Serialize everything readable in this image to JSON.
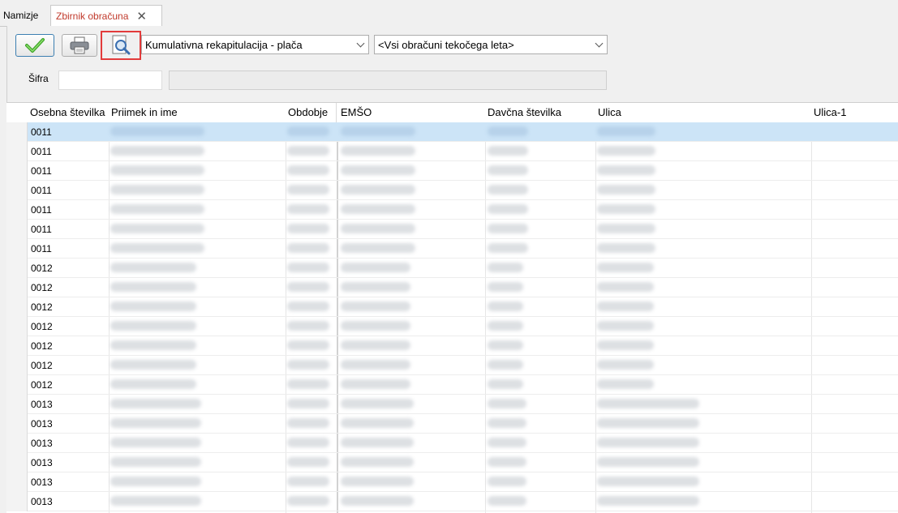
{
  "tabs": [
    {
      "label": "Namizje"
    },
    {
      "label": "Zbirnik obračuna"
    }
  ],
  "toolbar": {
    "ok_icon": "checkmark-icon",
    "print_icon": "printer-icon",
    "preview_icon": "print-preview-icon",
    "report_select": "Kumulativna rekapitulacija - plača",
    "period_select": "<Vsi obračuni tekočega leta>"
  },
  "filter": {
    "sifra_label": "Šifra",
    "sifra_value": "",
    "sifra_description": ""
  },
  "grid": {
    "columns": [
      "Osebna številka",
      "Priimek in ime",
      "Obdobje",
      "EMŠO",
      "Davčna številka",
      "Ulica",
      "Ulica-1"
    ],
    "rows": [
      {
        "id": "0011",
        "selected": true
      },
      {
        "id": "0011"
      },
      {
        "id": "0011"
      },
      {
        "id": "0011"
      },
      {
        "id": "0011"
      },
      {
        "id": "0011"
      },
      {
        "id": "0011"
      },
      {
        "id": "0012"
      },
      {
        "id": "0012"
      },
      {
        "id": "0012"
      },
      {
        "id": "0012"
      },
      {
        "id": "0012"
      },
      {
        "id": "0012"
      },
      {
        "id": "0012"
      },
      {
        "id": "0013"
      },
      {
        "id": "0013"
      },
      {
        "id": "0013"
      },
      {
        "id": "0013"
      },
      {
        "id": "0013"
      },
      {
        "id": "0013"
      }
    ]
  },
  "colors": {
    "selected_row": "#cce4f7",
    "active_tab_text": "#c0392b",
    "highlight_border": "#e23b3b"
  }
}
